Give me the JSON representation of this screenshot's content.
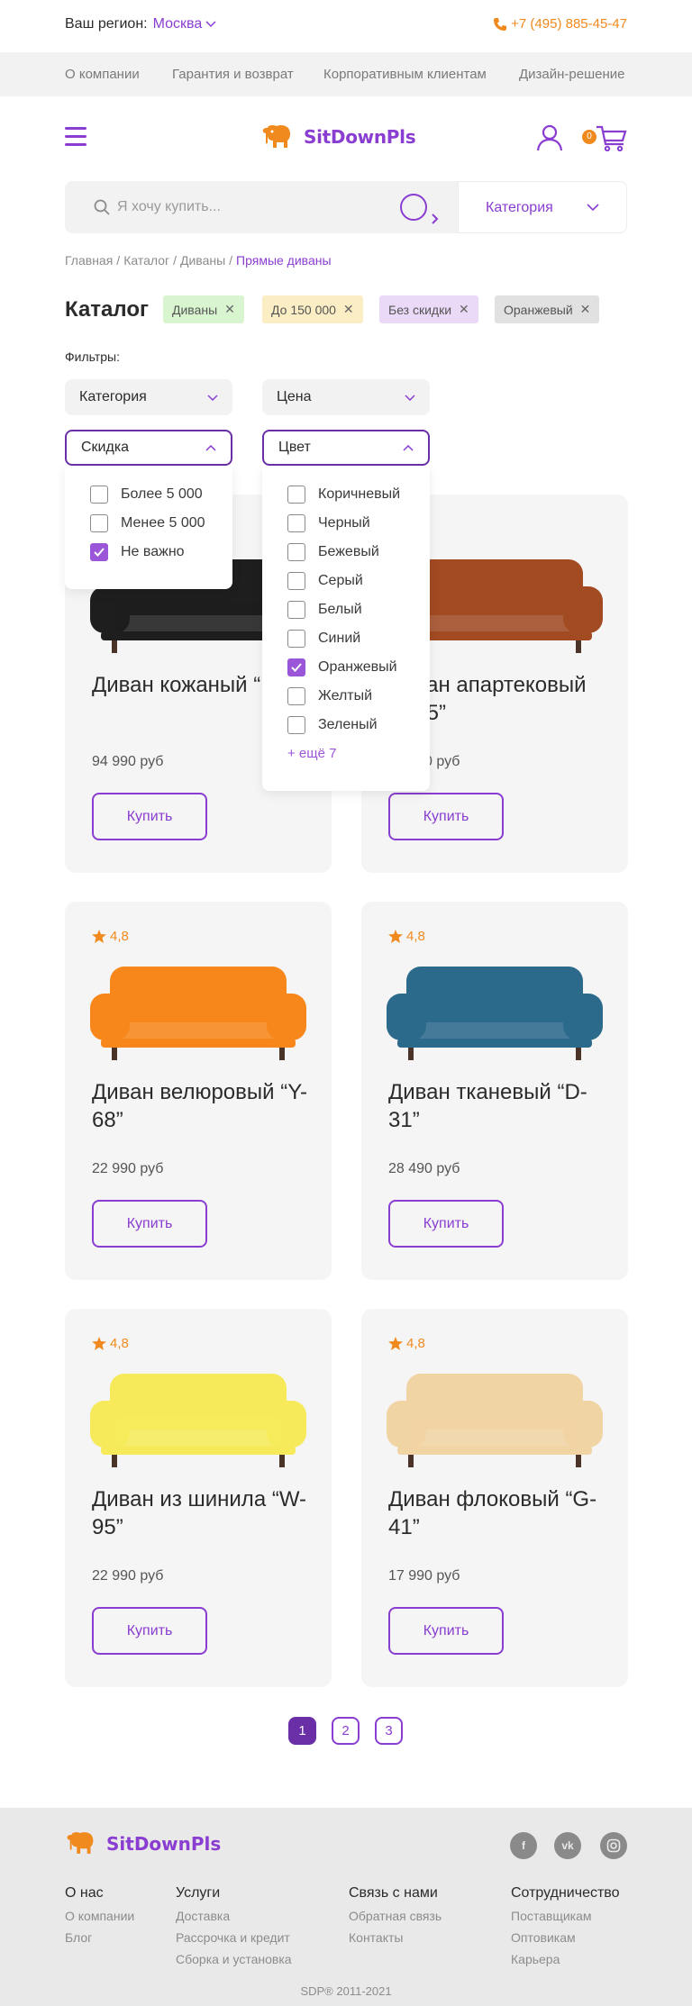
{
  "top": {
    "region_label": "Ваш регион:",
    "region_city": "Москва",
    "phone": "+7 (495) 885-45-47"
  },
  "menu": [
    "О компании",
    "Гарантия и возврат",
    "Корпоративным клиентам",
    "Дизайн-решение"
  ],
  "header": {
    "logo_text": "SitDownPls",
    "cart_count": "0"
  },
  "search": {
    "placeholder": "Я хочу купить...",
    "category_label": "Категория"
  },
  "breadcrumb": [
    "Главная",
    "Каталог",
    "Диваны",
    "Прямые диваны"
  ],
  "catalog": {
    "title": "Каталог",
    "chips": [
      {
        "label": "Диваны",
        "color": "#d8f5cf"
      },
      {
        "label": "До 150 000",
        "color": "#fbeec4"
      },
      {
        "label": "Без скидки",
        "color": "#ead9f7"
      },
      {
        "label": "Оранжевый",
        "color": "#e1e1e1"
      }
    ],
    "filters_label": "Фильтры:",
    "selects": [
      "Категория",
      "Цена",
      "Скидка",
      "Цвет"
    ]
  },
  "discount_options": [
    {
      "label": "Более 5 000",
      "checked": false
    },
    {
      "label": "Менее 5 000",
      "checked": false
    },
    {
      "label": "Не важно",
      "checked": true
    }
  ],
  "color_options": [
    {
      "label": "Коричневый",
      "checked": false
    },
    {
      "label": "Черный",
      "checked": false
    },
    {
      "label": "Бежевый",
      "checked": false
    },
    {
      "label": "Серый",
      "checked": false
    },
    {
      "label": "Белый",
      "checked": false
    },
    {
      "label": "Синий",
      "checked": false
    },
    {
      "label": "Оранжевый",
      "checked": true
    },
    {
      "label": "Желтый",
      "checked": false
    },
    {
      "label": "Зеленый",
      "checked": false
    }
  ],
  "color_more": "+ ещё 7",
  "products": [
    {
      "title": "Диван кожаный “R-94”",
      "price": "94 990 руб",
      "rating": "",
      "buy": "Купить",
      "sofa_color": "#1e1e1e"
    },
    {
      "title": "Диван апартековый “L-35”",
      "price": "31 990 руб",
      "rating": "",
      "buy": "Купить",
      "sofa_color": "#a24a22"
    },
    {
      "title": "Диван велюровый “Y-68”",
      "price": "22 990 руб",
      "rating": "4,8",
      "buy": "Купить",
      "sofa_color": "#f7861b"
    },
    {
      "title": "Диван тканевый “D-31”",
      "price": "28 490 руб",
      "rating": "4,8",
      "buy": "Купить",
      "sofa_color": "#2c6a8c"
    },
    {
      "title": "Диван из шинила “W-95”",
      "price": "22 990 руб",
      "rating": "4,8",
      "buy": "Купить",
      "sofa_color": "#f6ea5a"
    },
    {
      "title": "Диван флоковый “G-41”",
      "price": "17 990 руб",
      "rating": "4,8",
      "buy": "Купить",
      "sofa_color": "#f1d4a4"
    }
  ],
  "pagination": [
    "1",
    "2",
    "3"
  ],
  "footer": {
    "logo_text": "SitDownPls",
    "social": [
      "facebook-icon",
      "vk-icon",
      "instagram-icon"
    ],
    "columns": [
      {
        "head": "О нас",
        "links": [
          "О компании",
          "Блог"
        ]
      },
      {
        "head": "Услуги",
        "links": [
          "Доставка",
          "Рассрочка и кредит",
          "Сборка и установка"
        ]
      },
      {
        "head": "Связь с нами",
        "links": [
          "Обратная связь",
          "Контакты"
        ]
      },
      {
        "head": "Сотрудничество",
        "links": [
          "Поставщикам",
          "Оптовикам",
          "Карьера"
        ]
      }
    ],
    "copyright": "SDP®  2011-2021"
  },
  "colors": {
    "accent": "#8a3dd1",
    "orange": "#f08a1f"
  }
}
